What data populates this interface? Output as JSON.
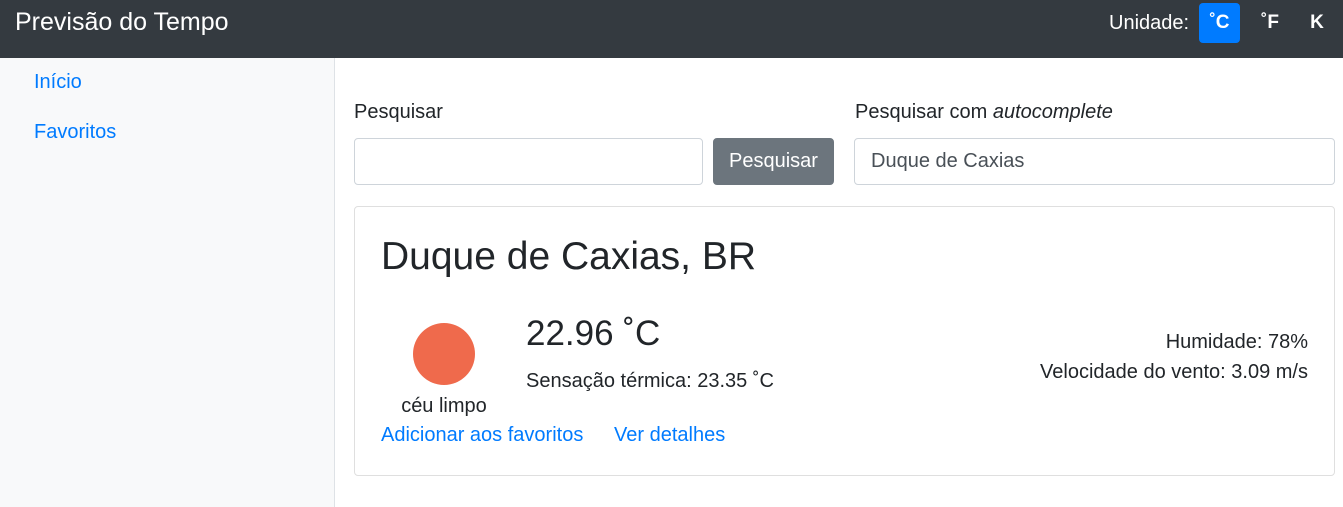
{
  "navbar": {
    "brand": "Previsão do Tempo",
    "unit_label": "Unidade:",
    "units": [
      "˚C",
      "˚F",
      "K"
    ],
    "active_unit": "˚C",
    "background_color": "#343a40",
    "accent_color": "#007bff"
  },
  "sidebar": {
    "items": [
      {
        "label": "Início"
      },
      {
        "label": "Favoritos"
      }
    ]
  },
  "search": {
    "label": "Pesquisar",
    "value": "",
    "button_label": "Pesquisar"
  },
  "autocomplete": {
    "label_prefix": "Pesquisar com ",
    "label_emphasis": "autocomplete",
    "value": "Duque de Caxias"
  },
  "weather": {
    "location": "Duque de Caxias, BR",
    "icon": "clear-sky-sun-icon",
    "icon_color": "#ef6a4c",
    "description": "céu limpo",
    "temperature": "22.96 ˚C",
    "feels_like": "Sensação térmica: 23.35 ˚C",
    "humidity": "Humidade: 78%",
    "wind_speed": "Velocidade do vento: 3.09 m/s",
    "add_favorite_label": "Adicionar aos favoritos",
    "details_label": "Ver detalhes"
  }
}
